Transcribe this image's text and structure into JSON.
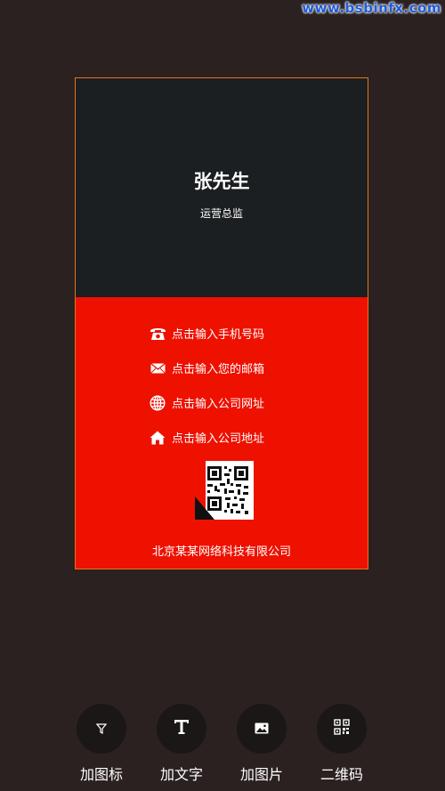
{
  "watermark": "www.bsbinfx.com",
  "card": {
    "name": "张先生",
    "title": "运营总监",
    "contacts": [
      {
        "icon": "phone-icon",
        "text": "点击输入手机号码"
      },
      {
        "icon": "mail-icon",
        "text": "点击输入您的邮箱"
      },
      {
        "icon": "globe-icon",
        "text": "点击输入公司网址"
      },
      {
        "icon": "home-icon",
        "text": "点击输入公司地址"
      }
    ],
    "company": "北京某某网络科技有限公司",
    "colors": {
      "top": "#1b1f21",
      "bottom": "#ee1100",
      "border": "#e8741a"
    }
  },
  "toolbar": [
    {
      "icon": "funnel-icon",
      "label": "加图标"
    },
    {
      "icon": "text-icon",
      "label": "加文字"
    },
    {
      "icon": "image-icon",
      "label": "加图片"
    },
    {
      "icon": "qrcode-icon",
      "label": "二维码"
    }
  ]
}
